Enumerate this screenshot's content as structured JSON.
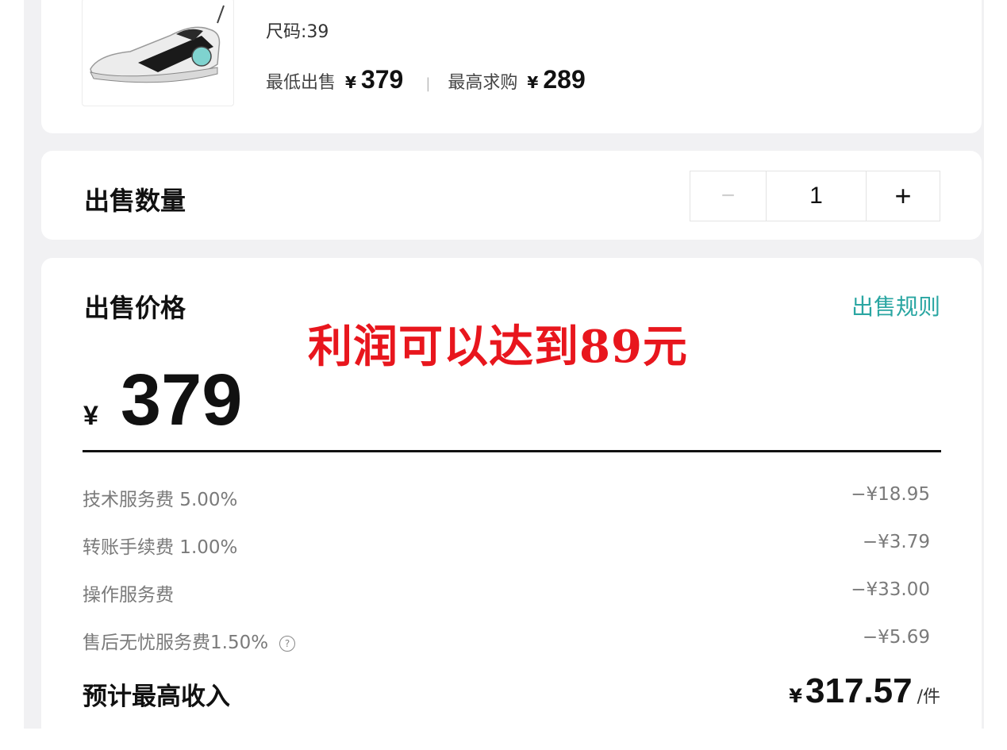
{
  "product": {
    "size_label": "尺码:39",
    "lowest_sell_label": "最低出售",
    "lowest_sell_currency": "¥",
    "lowest_sell_price": "379",
    "separator": "|",
    "highest_bid_label": "最高求购",
    "highest_bid_currency": "¥",
    "highest_bid_price": "289"
  },
  "quantity": {
    "label": "出售数量",
    "minus": "−",
    "value": "1",
    "plus": "+"
  },
  "price": {
    "label": "出售价格",
    "rules_link": "出售规则",
    "overlay_text": "利润可以达到89元",
    "currency": "¥",
    "value": "379"
  },
  "fees": [
    {
      "label": "技术服务费 5.00%",
      "amount": "−¥18.95"
    },
    {
      "label": "转账手续费 1.00%",
      "amount": "−¥3.79"
    },
    {
      "label": "操作服务费",
      "amount": "−¥33.00"
    },
    {
      "label": "售后无忧服务费1.50%",
      "amount": "−¥5.69"
    }
  ],
  "help_icon_glyph": "?",
  "income": {
    "label": "预计最高收入",
    "currency": "¥",
    "value": "317.57",
    "unit": "/件"
  },
  "colors": {
    "accent": "#2aa6a2",
    "overlay_red": "#e8161d"
  }
}
